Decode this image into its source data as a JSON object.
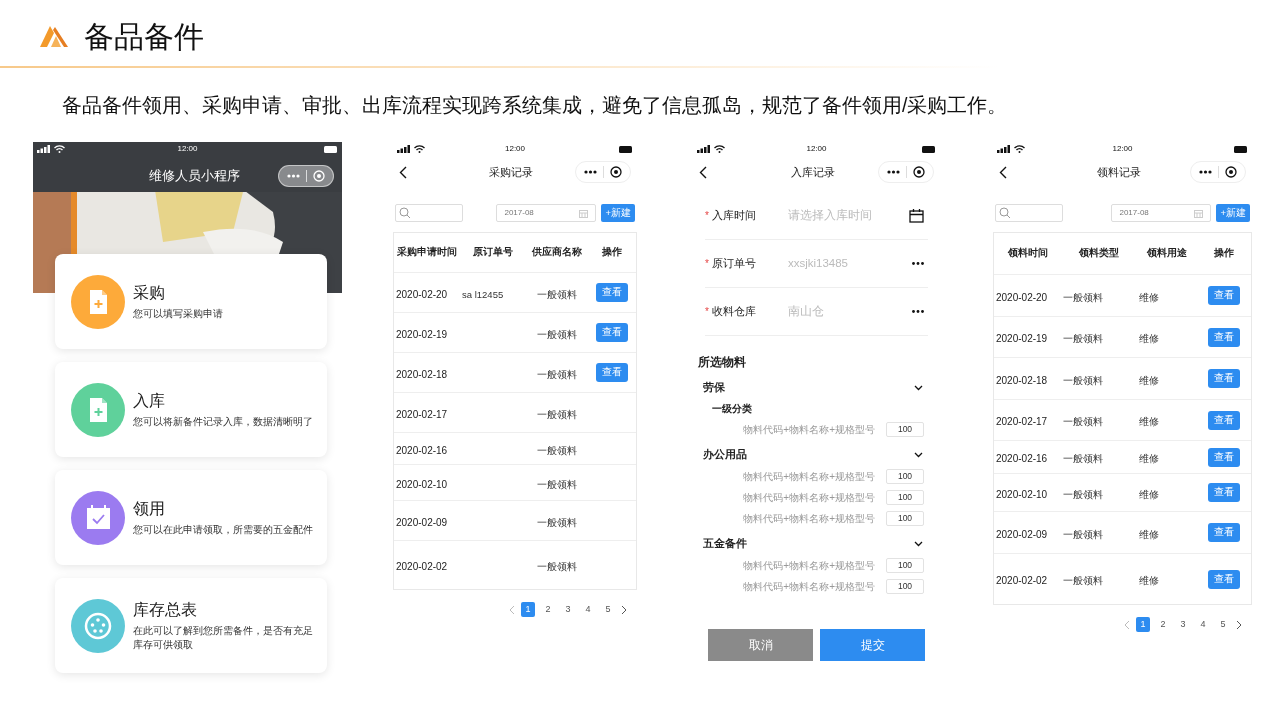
{
  "header": {
    "title": "备品备件",
    "description": "备品备件领用、采购申请、审批、出库流程实现跨系统集成，避免了信息孤岛，规范了备件领用/采购工作。"
  },
  "phones": [
    {
      "kind": "home",
      "time": "12:00",
      "title": "维修人员小程序",
      "cards": [
        {
          "title": "采购",
          "desc": "您可以填写采购申请",
          "color": "#fdaa3a",
          "kind": "document"
        },
        {
          "title": "入库",
          "desc": "您可以将新备件记录入库，数据清晰明了",
          "color": "#5fd19b",
          "kind": "document"
        },
        {
          "title": "领用",
          "desc": "您可以在此申请领取，所需要的五金配件",
          "color": "#9b7bf0",
          "kind": "calendar"
        },
        {
          "title": "库存总表",
          "desc": "在此可以了解到您所需备件，是否有充足库存可供领取",
          "color": "#5ec8d6",
          "kind": "disc"
        }
      ]
    },
    {
      "kind": "table",
      "time": "12:00",
      "title": "采购记录",
      "date": "2017-08",
      "new_button": "+新建",
      "columns": [
        "采购申请时间",
        "原订单号",
        "供应商名称",
        "操作"
      ],
      "rows": [
        {
          "cells": [
            "2020-02-20",
            "sa l12455",
            "一般领料"
          ],
          "action": "查看"
        },
        {
          "cells": [
            "2020-02-19",
            "",
            "一般领料"
          ],
          "action": "查看"
        },
        {
          "cells": [
            "2020-02-18",
            "",
            "一般领料"
          ],
          "action": "查看"
        },
        {
          "cells": [
            "2020-02-17",
            "",
            "一般领料"
          ]
        },
        {
          "cells": [
            "2020-02-16",
            "",
            "一般领料"
          ]
        },
        {
          "cells": [
            "2020-02-10",
            "",
            "一般领料"
          ]
        },
        {
          "cells": [
            "2020-02-09",
            "",
            "一般领料"
          ]
        },
        {
          "cells": [
            "2020-02-02",
            "",
            "一般领料"
          ]
        }
      ],
      "pages": [
        {
          "label": "1",
          "selected": true
        },
        {
          "label": "2",
          "selected": false
        },
        {
          "label": "3",
          "selected": false
        },
        {
          "label": "4",
          "selected": false
        },
        {
          "label": "5",
          "selected": false
        }
      ]
    },
    {
      "kind": "form",
      "time": "12:00",
      "title": "入库记录",
      "fields": [
        {
          "kind": "date",
          "required_mark": "*",
          "label": "入库时间",
          "placeholder": "请选择入库时间"
        },
        {
          "kind": "picker",
          "required_mark": "*",
          "label": "原订单号",
          "placeholder": "xxsjki13485"
        },
        {
          "kind": "picker",
          "required_mark": "*",
          "label": "收料仓库",
          "placeholder": "南山仓"
        }
      ],
      "section_title": "所选物料",
      "groups": [
        {
          "name": "劳保",
          "expanded": true,
          "entries": [
            {
              "kind": "subheading",
              "label": "一级分类"
            },
            {
              "kind": "item",
              "label": "物料代码+物料名称+规格型号",
              "qty": "100"
            }
          ]
        },
        {
          "name": "办公用品",
          "expanded": true,
          "entries": [
            {
              "kind": "item",
              "label": "物料代码+物料名称+规格型号",
              "qty": "100"
            },
            {
              "kind": "item",
              "label": "物料代码+物料名称+规格型号",
              "qty": "100"
            },
            {
              "kind": "item",
              "label": "物料代码+物料名称+规格型号",
              "qty": "100"
            }
          ]
        },
        {
          "name": "五金备件",
          "expanded": true,
          "entries": [
            {
              "kind": "item",
              "label": "物料代码+物料名称+规格型号",
              "qty": "100"
            },
            {
              "kind": "item",
              "label": "物料代码+物料名称+规格型号",
              "qty": "100"
            }
          ]
        }
      ],
      "cancel": "取消",
      "submit": "提交"
    },
    {
      "kind": "table",
      "time": "12:00",
      "title": "领料记录",
      "date": "2017-08",
      "new_button": "+新建",
      "columns": [
        "领料时间",
        "领料类型",
        "领料用途",
        "操作"
      ],
      "rows": [
        {
          "cells": [
            "2020-02-20",
            "一般领料",
            "维修"
          ],
          "action": "查看"
        },
        {
          "cells": [
            "2020-02-19",
            "一般领料",
            "维修"
          ],
          "action": "查看"
        },
        {
          "cells": [
            "2020-02-18",
            "一般领料",
            "维修"
          ],
          "action": "查看"
        },
        {
          "cells": [
            "2020-02-17",
            "一般领料",
            "维修"
          ],
          "action": "查看"
        },
        {
          "cells": [
            "2020-02-16",
            "一般领料",
            "维修"
          ],
          "action": "查看"
        },
        {
          "cells": [
            "2020-02-10",
            "一般领料",
            "维修"
          ],
          "action": "查看"
        },
        {
          "cells": [
            "2020-02-09",
            "一般领料",
            "维修"
          ],
          "action": "查看"
        },
        {
          "cells": [
            "2020-02-02",
            "一般领料",
            "维修"
          ],
          "action": "查看"
        }
      ],
      "pages": [
        {
          "label": "1",
          "selected": true
        },
        {
          "label": "2",
          "selected": false
        },
        {
          "label": "3",
          "selected": false
        },
        {
          "label": "4",
          "selected": false
        },
        {
          "label": "5",
          "selected": false
        }
      ]
    }
  ]
}
